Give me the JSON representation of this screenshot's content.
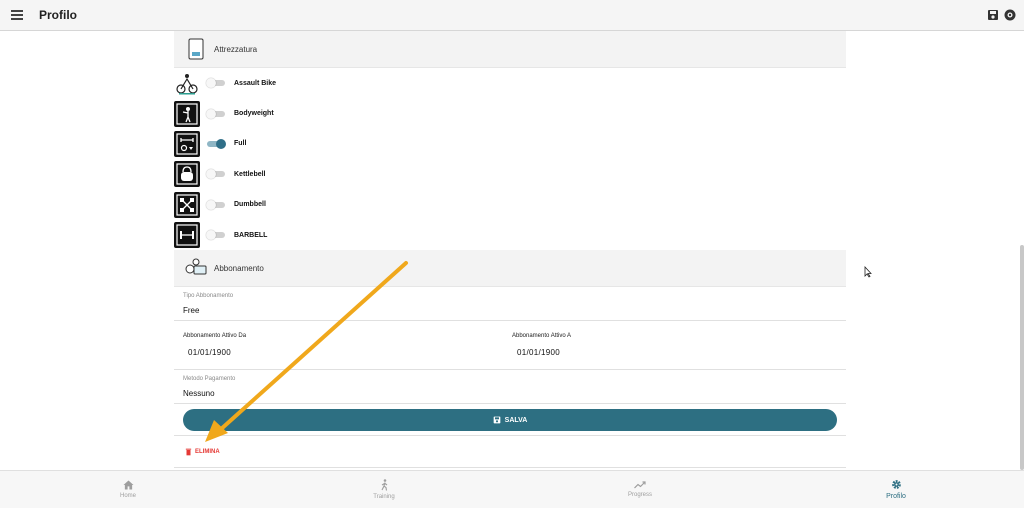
{
  "topbar": {
    "title": "Profilo"
  },
  "equipment": {
    "header": "Attrezzatura",
    "items": [
      {
        "label": "Assault Bike",
        "on": false,
        "icon": "assault-bike-icon"
      },
      {
        "label": "Bodyweight",
        "on": false,
        "icon": "bodyweight-icon"
      },
      {
        "label": "Full",
        "on": true,
        "icon": "full-gym-icon"
      },
      {
        "label": "Kettlebell",
        "on": false,
        "icon": "kettlebell-icon"
      },
      {
        "label": "Dumbbell",
        "on": false,
        "icon": "dumbbell-icon"
      },
      {
        "label": "BARBELL",
        "on": false,
        "icon": "barbell-icon"
      }
    ]
  },
  "subscription": {
    "header": "Abbonamento",
    "type_label": "Tipo Abbonamento",
    "type_value": "Free",
    "active_from_label": "Abbonamento Attivo Da",
    "active_from_value": "01/01/1900",
    "active_to_label": "Abbonamento Attivo A",
    "active_to_value": "01/01/1900",
    "payment_label": "Metodo Pagamento",
    "payment_value": "Nessuno"
  },
  "actions": {
    "save": "SALVA",
    "delete": "ELIMINA"
  },
  "bottom_nav": [
    {
      "label": "Home",
      "icon": "home-icon",
      "active": false
    },
    {
      "label": "Training",
      "icon": "walking-icon",
      "active": false
    },
    {
      "label": "Progress",
      "icon": "trend-icon",
      "active": false
    },
    {
      "label": "Profilo",
      "icon": "gear-icon",
      "active": true
    }
  ],
  "colors": {
    "accent": "#2d6f82",
    "delete": "#e53935",
    "annotation_arrow": "#f0a81c"
  }
}
